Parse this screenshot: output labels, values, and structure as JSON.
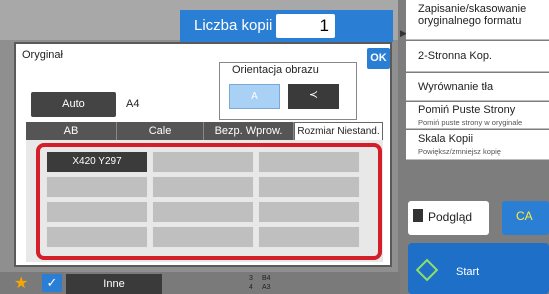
{
  "header": {
    "copies_label": "Liczba kopii",
    "copies_value": "1"
  },
  "right_panel": {
    "items": [
      {
        "title": "Zapisanie/skasowanie oryginalnego formatu",
        "subtitle": ""
      },
      {
        "title": "2-Stronna Kop.",
        "subtitle": ""
      },
      {
        "title": "Wyrównanie tła",
        "subtitle": ""
      },
      {
        "title": "Pomiń Puste Strony",
        "subtitle": "Pomiń puste strony w oryginale"
      },
      {
        "title": "Skala Kopii",
        "subtitle": "Powiększ/zmniejsz kopię"
      }
    ],
    "preview_label": "Podgląd",
    "ca_label": "CA",
    "start_label": "Start"
  },
  "bottom": {
    "inne_label": "Inne",
    "tray_b4": "B4",
    "tray_a3": "A3",
    "tray_b4_num": "3",
    "tray_a3_num": "4"
  },
  "dialog": {
    "title": "Oryginał",
    "ok_label": "OK",
    "orientation_label": "Orientacja obrazu",
    "orientation_portrait": "A",
    "orientation_landscape": "≺",
    "auto_label": "Auto",
    "size_value": "A4",
    "tabs": [
      "AB",
      "Cale",
      "Bezp. Wprow.",
      "Rozmiar Niestand."
    ],
    "active_tab_index": 3,
    "custom_sizes": [
      "X420 Y297",
      "",
      "",
      "",
      "",
      "",
      "",
      "",
      "",
      "",
      "",
      ""
    ]
  },
  "colors": {
    "accent": "#2a7fd4",
    "highlight": "#d41f2a"
  }
}
